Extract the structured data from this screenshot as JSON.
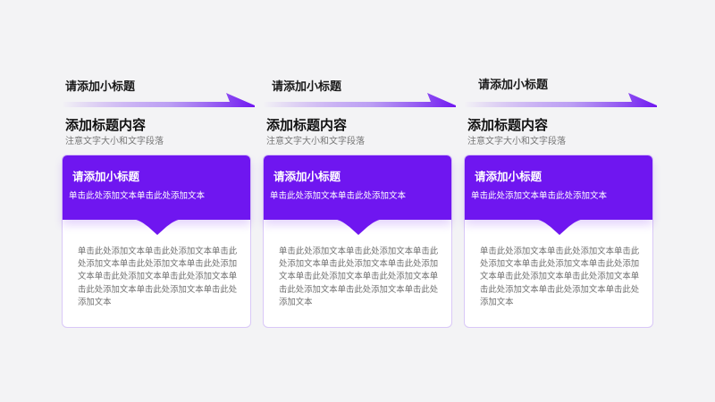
{
  "colors": {
    "accent": "#6f16f0",
    "background": "#f3f3f5",
    "card_border": "#d9c8f7",
    "body_text": "#707070"
  },
  "columns": [
    {
      "arrow_title": "请添加小标题",
      "heading": "添加标题内容",
      "subheading": "注意文字大小和文字段落",
      "card_title": "请添加小标题",
      "card_desc": "单击此处添加文本单击此处添加文本",
      "card_body": "单击此处添加文本单击此处添加文本单击此处添加文本单击此处添加文本单击此处添加文本单击此处添加文本单击此处添加文本单击此处添加文本单击此处添加文本单击此处添加文本"
    },
    {
      "arrow_title": "请添加小标题",
      "heading": "添加标题内容",
      "subheading": "注意文字大小和文字段落",
      "card_title": "请添加小标题",
      "card_desc": "单击此处添加文本单击此处添加文本",
      "card_body": "单击此处添加文本单击此处添加文本单击此处添加文本单击此处添加文本单击此处添加文本单击此处添加文本单击此处添加文本单击此处添加文本单击此处添加文本单击此处添加文本"
    },
    {
      "arrow_title": "请添加小标题",
      "heading": "添加标题内容",
      "subheading": "注意文字大小和文字段落",
      "card_title": "请添加小标题",
      "card_desc": "单击此处添加文本单击此处添加文本",
      "card_body": "单击此处添加文本单击此处添加文本单击此处添加文本单击此处添加文本单击此处添加文本单击此处添加文本单击此处添加文本单击此处添加文本单击此处添加文本单击此处添加文本"
    }
  ]
}
